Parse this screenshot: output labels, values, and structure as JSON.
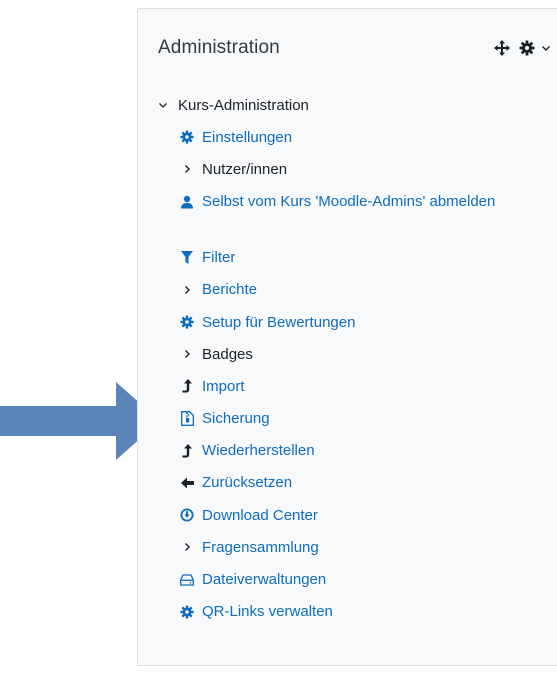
{
  "block": {
    "title": "Administration",
    "icons": [
      "move-icon",
      "gear-icon",
      "chevron-down-icon"
    ]
  },
  "tree": {
    "root_label": "Kurs-Administration",
    "items": [
      {
        "label": "Einstellungen",
        "icon": "gear-icon",
        "type": "link"
      },
      {
        "label": "Nutzer/innen",
        "icon": "chevron-right-icon",
        "type": "branch"
      },
      {
        "label": "Selbst vom Kurs 'Moodle-Admins' abmelden",
        "icon": "user-icon",
        "type": "link"
      },
      {
        "label": "Filter",
        "icon": "filter-icon",
        "type": "link"
      },
      {
        "label": "Berichte",
        "icon": "chevron-right-icon",
        "type": "branch-link"
      },
      {
        "label": "Setup für Bewertungen",
        "icon": "gear-icon",
        "type": "link"
      },
      {
        "label": "Badges",
        "icon": "chevron-right-icon",
        "type": "branch"
      },
      {
        "label": "Import",
        "icon": "level-up-icon",
        "type": "link"
      },
      {
        "label": "Sicherung",
        "icon": "file-archive-icon",
        "type": "link"
      },
      {
        "label": "Wiederherstellen",
        "icon": "level-up-icon",
        "type": "link"
      },
      {
        "label": "Zurücksetzen",
        "icon": "arrow-left-icon",
        "type": "link"
      },
      {
        "label": "Download Center",
        "icon": "download-circle-icon",
        "type": "link"
      },
      {
        "label": "Fragensammlung",
        "icon": "chevron-right-icon",
        "type": "branch-link"
      },
      {
        "label": "Dateiverwaltungen",
        "icon": "hdd-icon",
        "type": "link"
      },
      {
        "label": "QR-Links verwalten",
        "icon": "gear-icon",
        "type": "link"
      }
    ]
  },
  "colors": {
    "link": "#0f6cbf",
    "text": "#1d2125",
    "arrow": "#5b85b8",
    "block_bg": "#f8f9fa"
  }
}
